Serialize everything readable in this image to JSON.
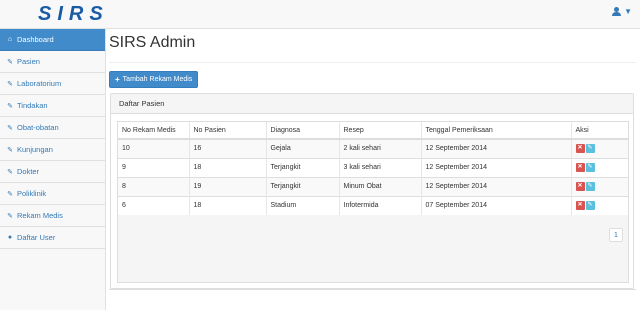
{
  "brand": "SIRS",
  "navbar": {
    "user_icon": "user-icon",
    "caret_icon": "chevron-down-icon"
  },
  "sidebar": {
    "items": [
      {
        "label": "Dashboard",
        "icon": "home-icon",
        "active": true
      },
      {
        "label": "Pasien",
        "icon": "pencil-icon"
      },
      {
        "label": "Laboratorium",
        "icon": "pencil-icon"
      },
      {
        "label": "Tindakan",
        "icon": "pencil-icon"
      },
      {
        "label": "Obat-obatan",
        "icon": "pencil-icon"
      },
      {
        "label": "Kunjungan",
        "icon": "pencil-icon"
      },
      {
        "label": "Dokter",
        "icon": "pencil-icon"
      },
      {
        "label": "Poliklinik",
        "icon": "pencil-icon"
      },
      {
        "label": "Rekam Medis",
        "icon": "pencil-icon"
      },
      {
        "label": "Daftar User",
        "icon": "user-icon"
      }
    ]
  },
  "main": {
    "title": "SIRS Admin",
    "add_button": "Tambah Rekam Medis",
    "panel_title": "Daftar Pasien",
    "table": {
      "headers": [
        "No Rekam Medis",
        "No Pasien",
        "Diagnosa",
        "Resep",
        "Tenggal Pemeriksaan",
        "Aksi"
      ],
      "rows": [
        [
          "10",
          "16",
          "Gejala",
          "2 kali sehari",
          "12 September 2014"
        ],
        [
          "9",
          "18",
          "Terjangkit",
          "3 kali sehari",
          "12 September 2014"
        ],
        [
          "8",
          "19",
          "Terjangkit",
          "Minum Obat",
          "12 September 2014"
        ],
        [
          "6",
          "18",
          "Stadium",
          "Infotermida",
          "07 September 2014"
        ]
      ]
    },
    "pagination": {
      "current": "1"
    }
  },
  "colors": {
    "primary": "#428bca",
    "danger": "#d9534f",
    "info": "#5bc0de",
    "brand": "#1a5ba6"
  }
}
